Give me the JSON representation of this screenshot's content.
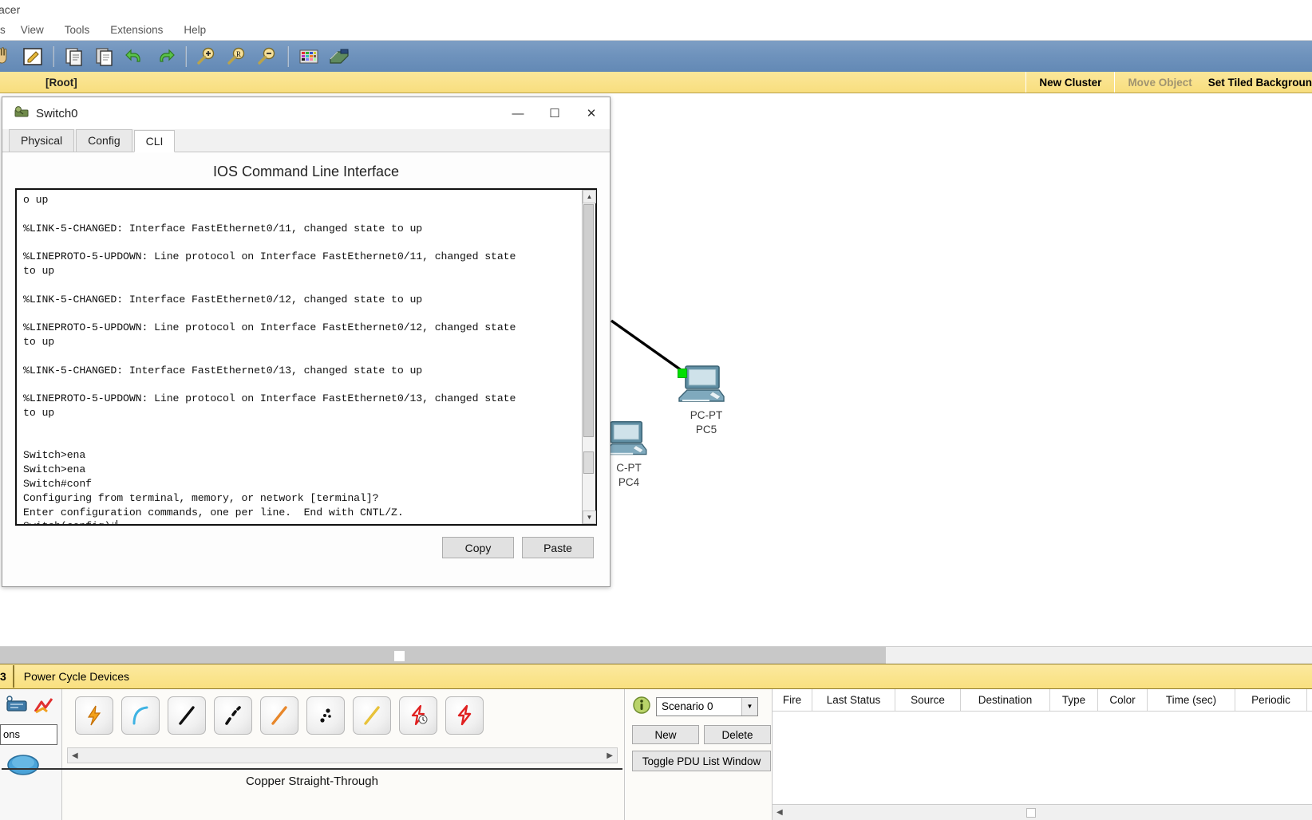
{
  "window": {
    "app_title": "acer",
    "menu": [
      "s",
      "View",
      "Tools",
      "Extensions",
      "Help"
    ]
  },
  "toolbar": {
    "icons": [
      "hand-icon",
      "draw-note-icon",
      "copy-icon",
      "paste-icon",
      "undo-icon",
      "redo-icon",
      "zoom-in-icon",
      "zoom-reset-icon",
      "zoom-out-icon",
      "palette-icon",
      "custom-devices-icon"
    ]
  },
  "cluster_bar": {
    "root_label": "[Root]",
    "new_cluster": "New Cluster",
    "move_object": "Move Object",
    "set_tiled_background": "Set Tiled Backgroun"
  },
  "workspace": {
    "devices": [
      {
        "type_label": "PC-PT",
        "name": "PC5"
      },
      {
        "type_label": "C-PT",
        "name": "PC4"
      }
    ]
  },
  "dialog": {
    "title": "Switch0",
    "window_buttons": {
      "minimize": "—",
      "maximize": "☐",
      "close": "✕"
    },
    "tabs": [
      {
        "label": "Physical",
        "active": false
      },
      {
        "label": "Config",
        "active": false
      },
      {
        "label": "CLI",
        "active": true
      }
    ],
    "heading": "IOS Command Line Interface",
    "terminal_text": "o up\n\n%LINK-5-CHANGED: Interface FastEthernet0/11, changed state to up\n\n%LINEPROTO-5-UPDOWN: Line protocol on Interface FastEthernet0/11, changed state\nto up\n\n%LINK-5-CHANGED: Interface FastEthernet0/12, changed state to up\n\n%LINEPROTO-5-UPDOWN: Line protocol on Interface FastEthernet0/12, changed state\nto up\n\n%LINK-5-CHANGED: Interface FastEthernet0/13, changed state to up\n\n%LINEPROTO-5-UPDOWN: Line protocol on Interface FastEthernet0/13, changed state\nto up\n\n\nSwitch>ena\nSwitch>ena\nSwitch#conf\nConfiguring from terminal, memory, or network [terminal]?\nEnter configuration commands, one per line.  End with CNTL/Z.\nSwitch(config)#",
    "copy_label": "Copy",
    "paste_label": "Paste"
  },
  "power_bar": {
    "left_number": "3",
    "label": "Power Cycle Devices"
  },
  "device_dock": {
    "search_value": "ons",
    "icons": [
      "network-devices-icon",
      "connections-icon",
      "end-devices-icon"
    ]
  },
  "connections": {
    "items": [
      {
        "name": "automatically-choose-connection-type",
        "color": "#ef8a1b"
      },
      {
        "name": "console-cable",
        "color": "#3fb3e3"
      },
      {
        "name": "copper-straight-through-cable",
        "color": "#111111"
      },
      {
        "name": "copper-cross-over-cable",
        "color": "#111111"
      },
      {
        "name": "fiber-cable",
        "color": "#e8872a"
      },
      {
        "name": "phone-cable",
        "color": "#111111"
      },
      {
        "name": "coaxial-cable",
        "color": "#e8c23a"
      },
      {
        "name": "serial-dce-cable",
        "color": "#e02020"
      },
      {
        "name": "serial-dte-cable",
        "color": "#e02020"
      }
    ],
    "selected_name": "Copper Straight-Through"
  },
  "scenario": {
    "selected": "Scenario 0",
    "new_label": "New",
    "delete_label": "Delete",
    "toggle_label": "Toggle PDU List Window"
  },
  "pdu_list": {
    "columns": [
      "Fire",
      "Last Status",
      "Source",
      "Destination",
      "Type",
      "Color",
      "Time (sec)",
      "Periodic"
    ],
    "rows": []
  },
  "colors": {
    "toolbar_blue": "#6f93bd",
    "yellow_bar": "#f8de7e",
    "link_status_green": "#00e000"
  }
}
